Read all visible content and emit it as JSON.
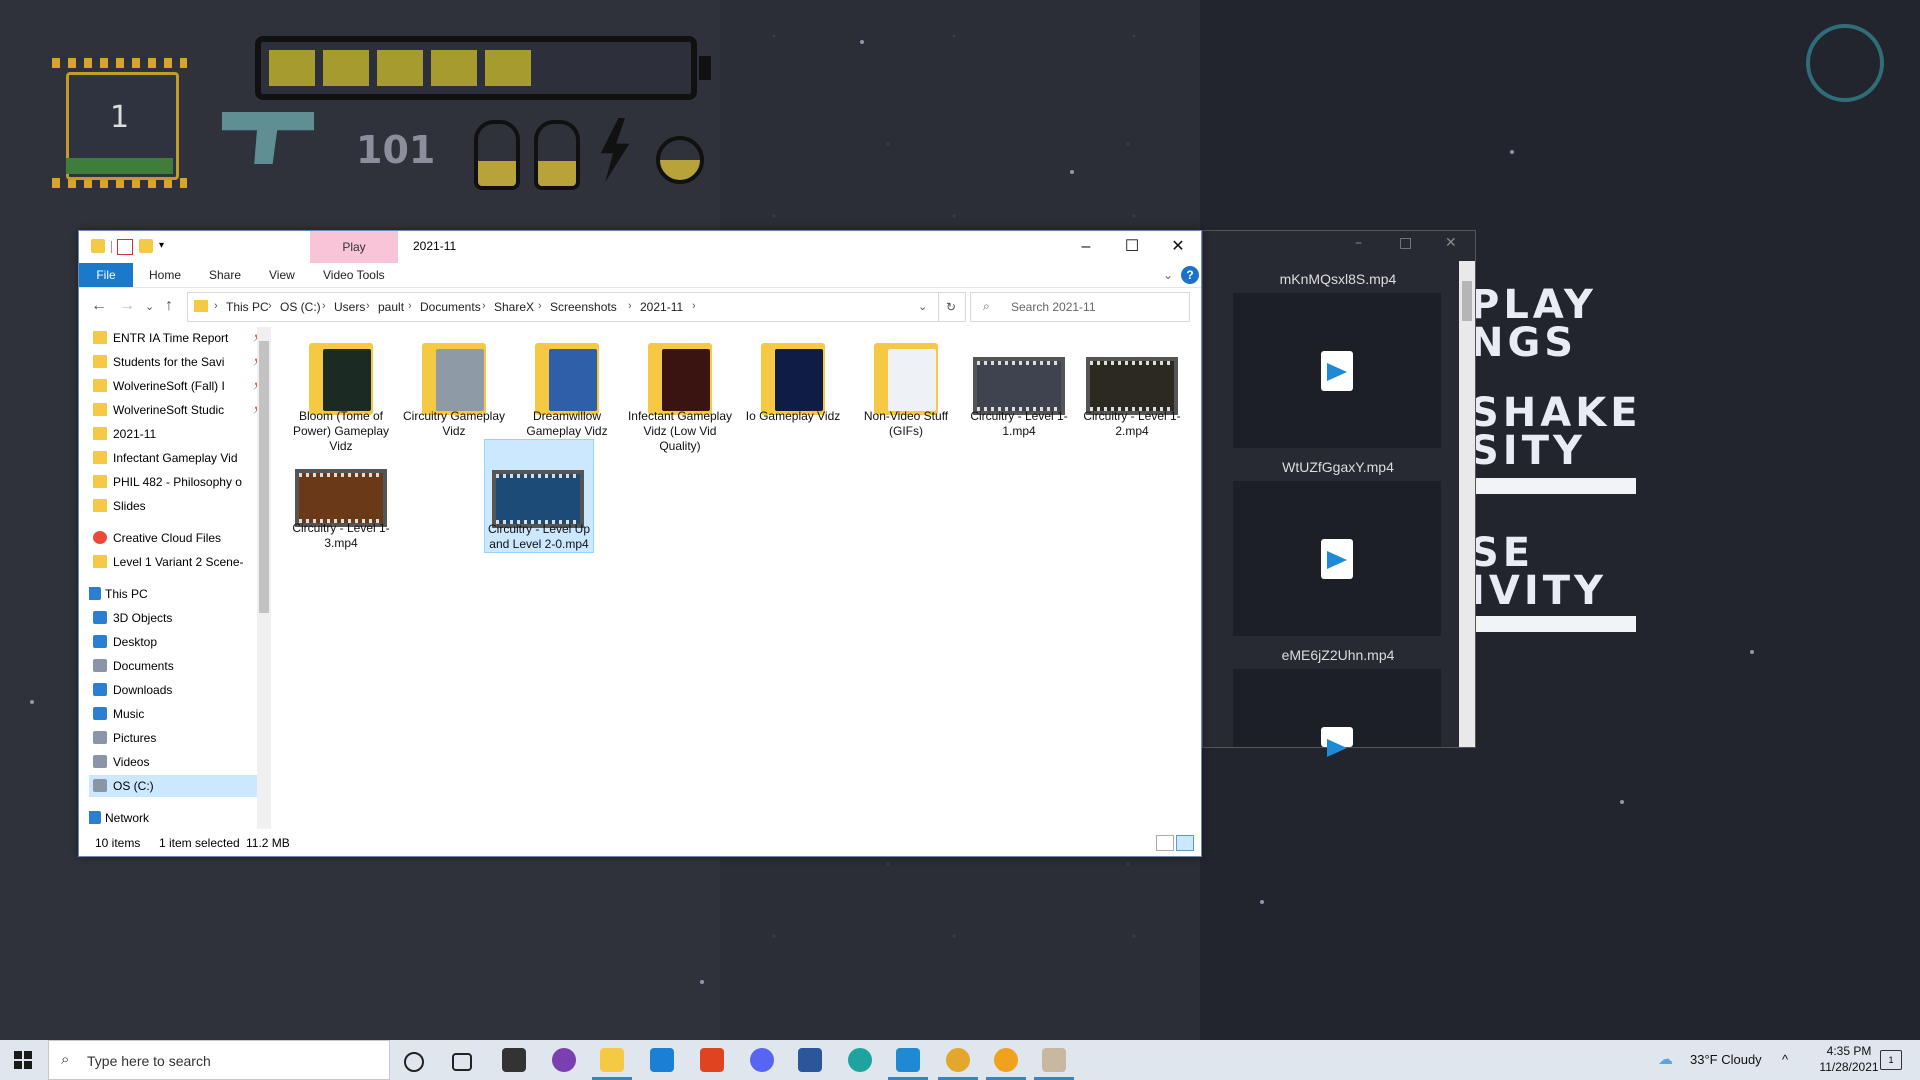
{
  "game": {
    "level_number": "1",
    "ammo_count": "101",
    "menu_lines": [
      "PLAY",
      "NGS",
      "SHAKE",
      "SITY",
      "SE",
      "IVITY"
    ]
  },
  "video_window": {
    "files": [
      "mKnMQsxl8S.mp4",
      "WtUZfGgaxY.mp4",
      "eME6jZ2Uhn.mp4"
    ]
  },
  "explorer": {
    "context_tab": "Play",
    "window_title": "2021-11",
    "ribbon_tabs": [
      "File",
      "Home",
      "Share",
      "View",
      "Video Tools"
    ],
    "breadcrumbs": [
      "This PC",
      "OS (C:)",
      "Users",
      "pault",
      "Documents",
      "ShareX",
      "Screenshots",
      "2021-11"
    ],
    "search_placeholder": "Search 2021-11",
    "nav_items": [
      {
        "label": "ENTR IA Time Report",
        "pinned": true
      },
      {
        "label": "Students for the Savi",
        "pinned": true
      },
      {
        "label": "WolverineSoft (Fall) I",
        "pinned": true
      },
      {
        "label": "WolverineSoft Studic",
        "pinned": true
      },
      {
        "label": "2021-11",
        "pinned": false
      },
      {
        "label": "Infectant Gameplay Vid",
        "pinned": false
      },
      {
        "label": "PHIL 482 - Philosophy o",
        "pinned": false
      },
      {
        "label": "Slides",
        "pinned": false
      },
      {
        "label": "Creative Cloud Files",
        "pinned": false
      },
      {
        "label": "Level 1 Variant 2 Scene-",
        "pinned": false
      },
      {
        "label": "This PC",
        "pinned": false
      },
      {
        "label": "3D Objects",
        "pinned": false
      },
      {
        "label": "Desktop",
        "pinned": false
      },
      {
        "label": "Documents",
        "pinned": false
      },
      {
        "label": "Downloads",
        "pinned": false
      },
      {
        "label": "Music",
        "pinned": false
      },
      {
        "label": "Pictures",
        "pinned": false
      },
      {
        "label": "Videos",
        "pinned": false
      },
      {
        "label": "OS (C:)",
        "pinned": false
      },
      {
        "label": "Network",
        "pinned": false
      }
    ],
    "items": [
      {
        "label": "Bloom (Tome of Power) Gameplay Vidz",
        "kind": "folder",
        "selected": false
      },
      {
        "label": "Circuitry Gameplay Vidz",
        "kind": "folder",
        "selected": false
      },
      {
        "label": "Dreamwillow Gameplay Vidz",
        "kind": "folder",
        "selected": false
      },
      {
        "label": "Infectant Gameplay Vidz (Low Vid Quality)",
        "kind": "folder",
        "selected": false
      },
      {
        "label": "Io Gameplay Vidz",
        "kind": "folder",
        "selected": false
      },
      {
        "label": "Non-Video Stuff (GIFs)",
        "kind": "folder",
        "selected": false
      },
      {
        "label": "Circuitry - Level 1-1.mp4",
        "kind": "video",
        "selected": false
      },
      {
        "label": "Circuitry - Level 1-2.mp4",
        "kind": "video",
        "selected": false
      },
      {
        "label": "Circuitry - Level 1-3.mp4",
        "kind": "video",
        "selected": false
      },
      {
        "label": "Circuitry - Level Up and Level 2-0.mp4",
        "kind": "video",
        "selected": true
      }
    ],
    "status": {
      "count": "10 items",
      "selection": "1 item selected",
      "size": "11.2 MB"
    }
  },
  "taskbar": {
    "search_placeholder": "Type here to search",
    "apps": [
      "cortana-icon",
      "task-view-icon",
      "store-icon",
      "github-icon",
      "file-explorer-icon",
      "mail-icon",
      "office-icon",
      "discord-icon",
      "word-icon",
      "edge-icon",
      "vscode-icon",
      "chrome-icon",
      "chrome-canary-icon",
      "app-icon"
    ],
    "weather": "33°F  Cloudy",
    "time": "4:35 PM",
    "date": "11/28/2021",
    "notifications": "1"
  },
  "colors": {
    "accent": "#1979ca",
    "selection": "#cce8ff",
    "play_tab": "#f9c4d8",
    "folder": "#f6c945"
  }
}
